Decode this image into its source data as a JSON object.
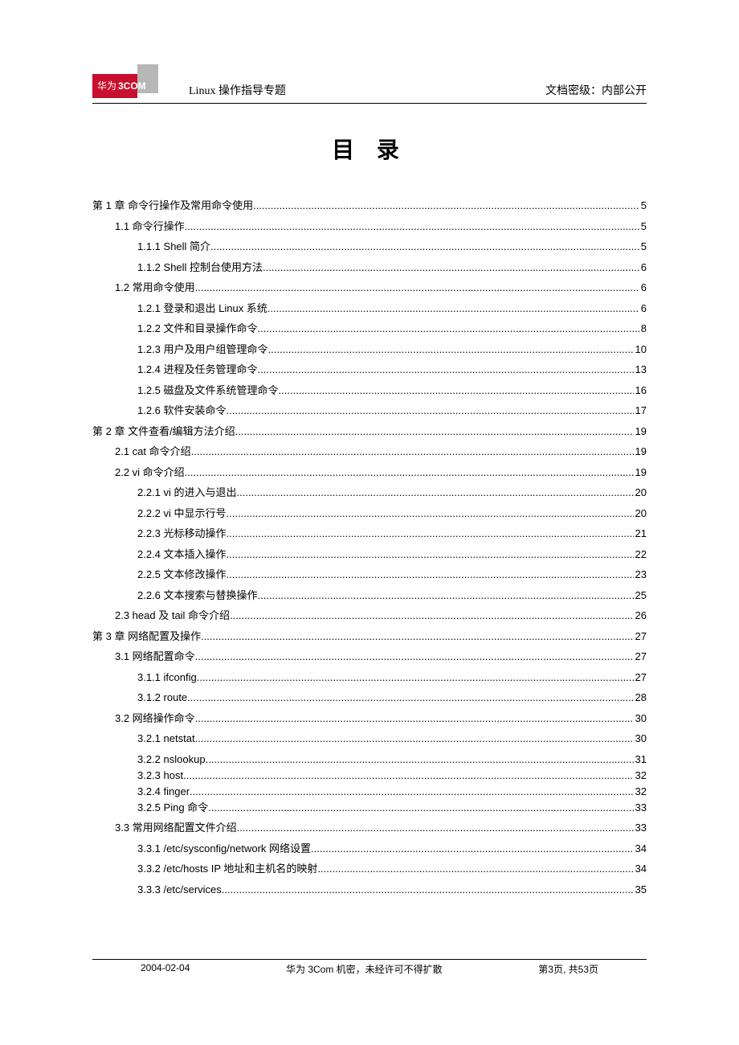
{
  "header": {
    "logo_text_left": "华为",
    "logo_text_right": "3COM",
    "doc_title": "Linux 操作指导专题",
    "classification_label": "文档密级：",
    "classification_value": "内部公开"
  },
  "toc_title": "目 录",
  "toc": [
    {
      "level": 1,
      "label": "第 1 章 命令行操作及常用命令使用",
      "page": "5"
    },
    {
      "level": 2,
      "label": "1.1 命令行操作",
      "page": "5"
    },
    {
      "level": 3,
      "label": "1.1.1 Shell 简介",
      "page": "5"
    },
    {
      "level": 3,
      "label": "1.1.2 Shell 控制台使用方法",
      "page": "6"
    },
    {
      "level": 2,
      "label": "1.2 常用命令使用",
      "page": "6"
    },
    {
      "level": 3,
      "label": "1.2.1 登录和退出 Linux 系统",
      "page": "6"
    },
    {
      "level": 3,
      "label": "1.2.2 文件和目录操作命令",
      "page": "8"
    },
    {
      "level": 3,
      "label": "1.2.3 用户及用户组管理命令",
      "page": "10"
    },
    {
      "level": 3,
      "label": "1.2.4 进程及任务管理命令",
      "page": "13"
    },
    {
      "level": 3,
      "label": "1.2.5 磁盘及文件系统管理命令",
      "page": "16"
    },
    {
      "level": 3,
      "label": "1.2.6 软件安装命令",
      "page": "17"
    },
    {
      "level": 1,
      "label": "第 2 章 文件查看/编辑方法介绍",
      "page": "19",
      "break": true
    },
    {
      "level": 2,
      "label": "2.1 cat 命令介绍",
      "page": "19"
    },
    {
      "level": 2,
      "label": "2.2 vi 命令介绍",
      "page": "19"
    },
    {
      "level": 3,
      "label": "2.2.1 vi 的进入与退出",
      "page": "20"
    },
    {
      "level": 3,
      "label": "2.2.2 vi 中显示行号",
      "page": "20"
    },
    {
      "level": 3,
      "label": "2.2.3 光标移动操作",
      "page": "21"
    },
    {
      "level": 3,
      "label": "2.2.4 文本插入操作",
      "page": "22"
    },
    {
      "level": 3,
      "label": "2.2.5 文本修改操作",
      "page": "23"
    },
    {
      "level": 3,
      "label": "2.2.6 文本搜索与替换操作",
      "page": "25"
    },
    {
      "level": 2,
      "label": "2.3 head 及 tail 命令介绍",
      "page": "26"
    },
    {
      "level": 1,
      "label": "第 3 章 网络配置及操作",
      "page": "27",
      "break": true
    },
    {
      "level": 2,
      "label": "3.1 网络配置命令",
      "page": "27"
    },
    {
      "level": 3,
      "label": "3.1.1 ifconfig",
      "page": "27"
    },
    {
      "level": 3,
      "label": "3.1.2 route",
      "page": "28"
    },
    {
      "level": 2,
      "label": "3.2 网络操作命令",
      "page": "30"
    },
    {
      "level": 3,
      "label": "3.2.1 netstat",
      "page": "30"
    },
    {
      "level": 3,
      "label": "3.2.2 nslookup",
      "page": "31",
      "tight": true
    },
    {
      "level": 3,
      "label": "3.2.3 host",
      "page": "32",
      "tight": true
    },
    {
      "level": 3,
      "label": "3.2.4 finger",
      "page": "32",
      "tight": true
    },
    {
      "level": 3,
      "label": "3.2.5 Ping 命令",
      "page": "33"
    },
    {
      "level": 2,
      "label": "3.3 常用网络配置文件介绍",
      "page": "33"
    },
    {
      "level": 3,
      "label": "3.3.1 /etc/sysconfig/network 网络设置",
      "page": "34"
    },
    {
      "level": 3,
      "label": "3.3.2 /etc/hosts IP 地址和主机名的映射",
      "page": "34"
    },
    {
      "level": 3,
      "label": "3.3.3 /etc/services",
      "page": "35"
    }
  ],
  "footer": {
    "date": "2004-02-04",
    "confidential": "华为 3Com 机密，未经许可不得扩散",
    "page_info": "第3页, 共53页"
  }
}
